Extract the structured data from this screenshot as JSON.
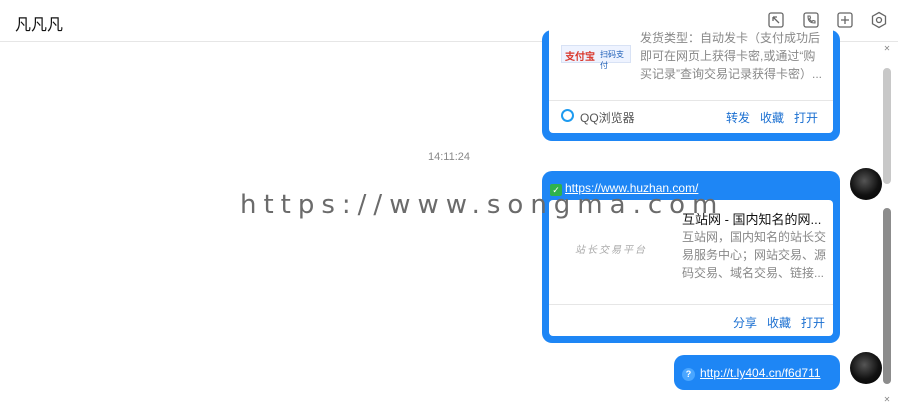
{
  "window": {
    "title": "凡凡凡"
  },
  "toolbar": {
    "icons": [
      "screenshot-icon",
      "phone-icon",
      "add-icon",
      "settings-icon"
    ]
  },
  "card1": {
    "logo_text": "扫码支付",
    "lines": [
      "发货类型：自动发卡（支付成功后",
      "即可在网页上获得卡密,或通过“购",
      "买记录”查询交易记录获得卡密）..."
    ],
    "source": "QQ浏览器",
    "actions": [
      "转发",
      "收藏",
      "打开"
    ]
  },
  "timestamp": "14:11:24",
  "message2": {
    "url": "https://www.huzhan.com/",
    "card_title": "互站网 - 国内知名的网...",
    "card_lines": [
      "互站网，国内知名的站长交",
      "易服务中心；网站交易、源",
      "码交易、域名交易、链接..."
    ],
    "thumb_text": "站长交易平台",
    "actions": [
      "分享",
      "收藏",
      "打开"
    ]
  },
  "message3": {
    "url": "http://t.ly404.cn/f6d711",
    "badge": "?"
  },
  "watermark": "https://www.songma.com",
  "colors": {
    "bubble": "#1e86f5",
    "link": "#1a6fd1"
  }
}
